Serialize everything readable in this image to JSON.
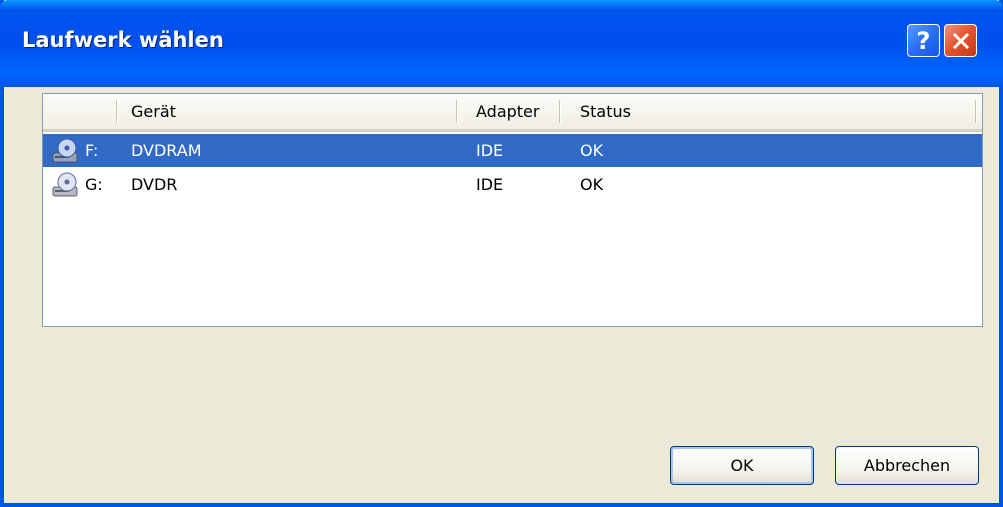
{
  "window": {
    "title": "Laufwerk wählen",
    "help_label": "?",
    "close_label": "✕"
  },
  "list": {
    "columns": [
      "Gerät",
      "Adapter",
      "Status"
    ],
    "rows": [
      {
        "letter": "F:",
        "device": "DVDRAM",
        "adapter": "IDE",
        "status": "OK",
        "selected": true,
        "icon": "cd-drive-icon"
      },
      {
        "letter": "G:",
        "device": "DVDR",
        "adapter": "IDE",
        "status": "OK",
        "selected": false,
        "icon": "cd-drive-icon"
      }
    ]
  },
  "buttons": {
    "ok": "OK",
    "cancel": "Abbrechen"
  },
  "colors": {
    "titlebar": "#0054e3",
    "selection": "#316ac5",
    "dialog_bg": "#ece9d8"
  }
}
